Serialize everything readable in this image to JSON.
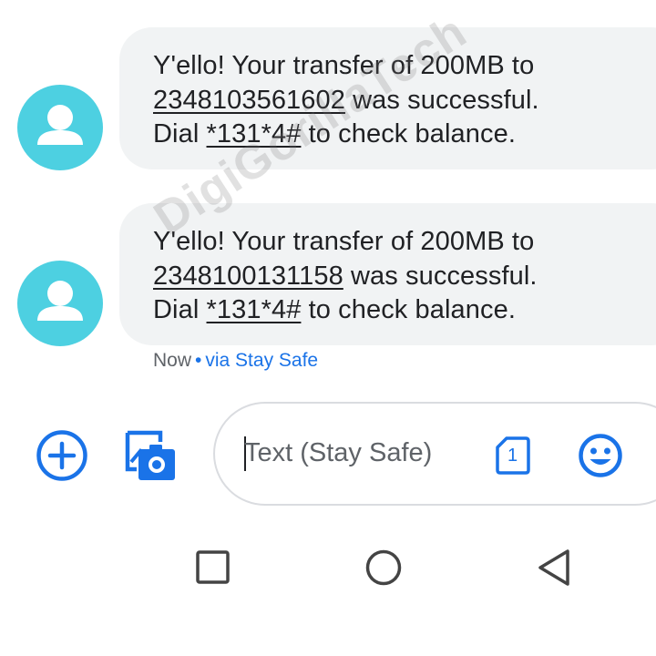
{
  "messages": [
    {
      "line1": "Y'ello! Your transfer of 200MB to",
      "number": "2348103561602",
      "line2_suffix": " was successful.",
      "line3_prefix": "Dial ",
      "code": "*131*4#",
      "line3_suffix": " to check balance."
    },
    {
      "line1": "Y'ello! Your transfer of 200MB to",
      "number": "2348100131158",
      "line2_suffix": " was successful.",
      "line3_prefix": "Dial ",
      "code": "*131*4#",
      "line3_suffix": " to check balance."
    }
  ],
  "meta": {
    "time": "Now",
    "separator": "•",
    "via": "via Stay Safe"
  },
  "watermark": "DigiGorillaTech",
  "compose": {
    "placeholder": "Text (Stay Safe)",
    "sim_label": "1",
    "icons": {
      "add": "add-circle-icon",
      "gallery": "add-photo-icon",
      "sim": "sim-card-icon",
      "emoji": "emoji-icon"
    }
  },
  "nav": {
    "icons": {
      "recents": "square-icon",
      "home": "circle-icon",
      "back": "triangle-back-icon"
    }
  },
  "colors": {
    "accent": "#1a73e8",
    "avatar": "#4dd0e1",
    "bubble": "#f1f3f4",
    "text": "#202124",
    "secondary_text": "#5f6368"
  }
}
